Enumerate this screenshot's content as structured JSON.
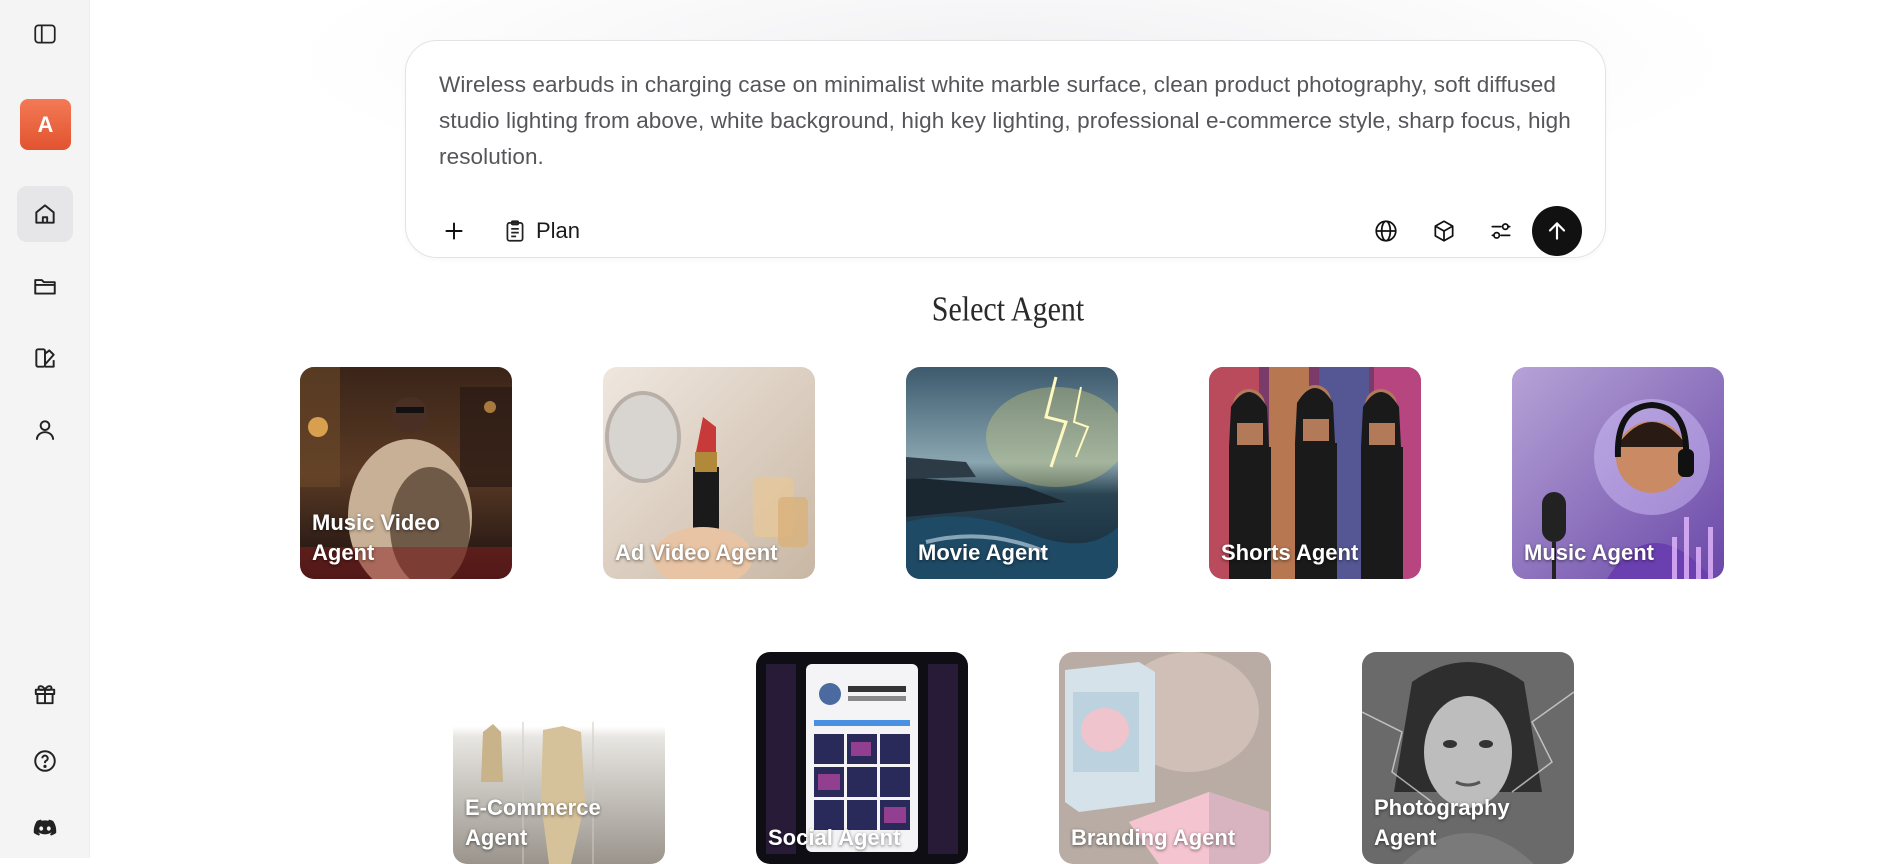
{
  "sidebar": {
    "avatar_letter": "A",
    "icons": [
      "sidebar-toggle-icon",
      "home-icon",
      "folder-icon",
      "palette-icon",
      "user-icon",
      "gift-icon",
      "help-icon",
      "discord-icon"
    ]
  },
  "prompt": {
    "text": "Wireless earbuds in charging case on minimalist white marble surface, clean product photography, soft diffused studio lighting from above, white background, high key lighting, professional e-commerce style, sharp focus, high resolution.",
    "plan_label": "Plan"
  },
  "agents": {
    "title": "Select Agent",
    "row1": [
      {
        "label": "Music Video Agent"
      },
      {
        "label": "Ad Video Agent"
      },
      {
        "label": "Movie Agent"
      },
      {
        "label": "Shorts Agent"
      },
      {
        "label": "Music Agent"
      }
    ],
    "row2": [
      {
        "label": "E-Commerce Agent"
      },
      {
        "label": "Social Agent"
      },
      {
        "label": "Branding Agent"
      },
      {
        "label": "Photography Agent"
      }
    ]
  },
  "colors": {
    "accent_avatar": "#e8603a",
    "send_button": "#111111"
  }
}
